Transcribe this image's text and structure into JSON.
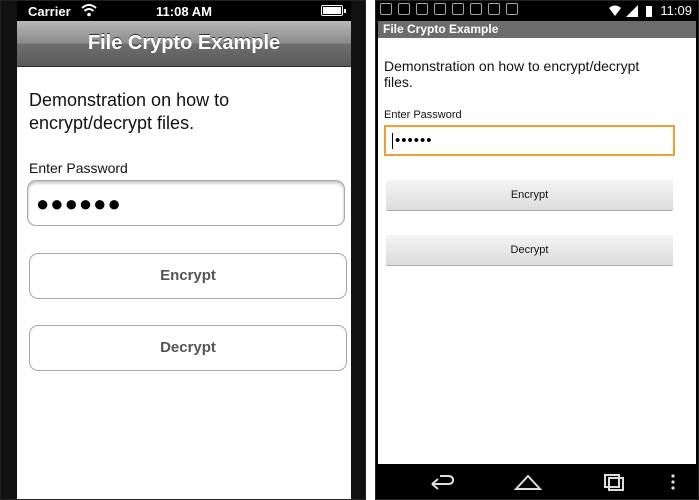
{
  "ios": {
    "status": {
      "carrier": "Carrier",
      "time": "11:08 AM"
    },
    "title": "File Crypto Example",
    "description": "Demonstration on how to encrypt/decrypt files.",
    "password_label": "Enter Password",
    "password_value": "●●●●●●",
    "encrypt_label": "Encrypt",
    "decrypt_label": "Decrypt",
    "icons": [
      "wifi-icon",
      "battery-icon"
    ]
  },
  "android": {
    "status": {
      "time": "11:09"
    },
    "title": "File Crypto Example",
    "description": "Demonstration on how to encrypt/decrypt files.",
    "password_label": "Enter Password",
    "password_value": "••••••",
    "encrypt_label": "Encrypt",
    "decrypt_label": "Decrypt",
    "accent_color": "#f0a030",
    "icons": [
      "back-icon",
      "home-icon",
      "recent-apps-icon",
      "menu-icon"
    ]
  }
}
